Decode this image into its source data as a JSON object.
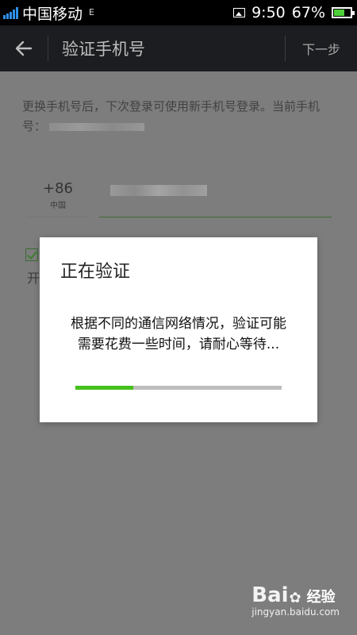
{
  "status_bar": {
    "carrier": "中国移动",
    "network_type": "E",
    "time": "9:50",
    "battery": "67%",
    "battery_level": 0.67,
    "icons": [
      "signal-icon",
      "image-notification-icon",
      "battery-icon"
    ]
  },
  "title_bar": {
    "title": "验证手机号",
    "next_label": "下一步",
    "back_icon": "back-arrow-icon"
  },
  "content": {
    "description": "更换手机号后，下次登录可使用新手机号登录。当前手机号：",
    "country_code": "+86",
    "country_name": "中国",
    "checkbox_checked": true,
    "cut_text": "开"
  },
  "dialog": {
    "title": "正在验证",
    "message": "根据不同的通信网络情况，验证可能需要花费一些时间，请耐心等待...",
    "progress": 0.28,
    "colors": {
      "progress_fill": "#45c11c",
      "progress_track": "#bdbdbd"
    }
  },
  "watermark": {
    "brand": "Bai",
    "brand_end": "经验",
    "url": "jingyan.baidu.com"
  }
}
